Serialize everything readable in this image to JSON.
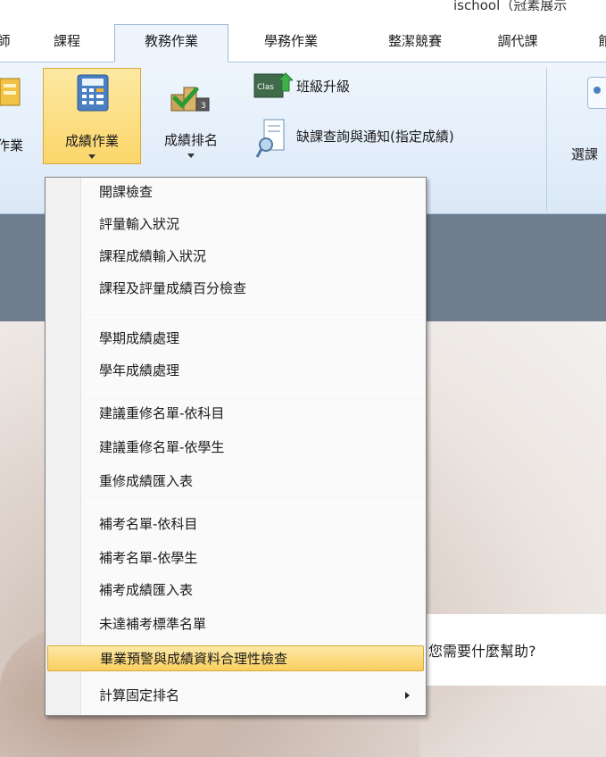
{
  "window": {
    "title": "ischool（冠素展示"
  },
  "tabs": [
    "師",
    "課程",
    "教務作業",
    "學務作業",
    "整潔競賽",
    "調代課",
    "館"
  ],
  "active_tab_index": 2,
  "ribbon": {
    "left_cut_label": "作業",
    "grade_ops_label": "成績作業",
    "grade_rank_label": "成績排名",
    "class_promote_label": "班級升級",
    "absence_notice_label": "缺課查詢與通知(指定成績)",
    "course_select_label": "選課"
  },
  "menu": {
    "groups": [
      [
        "開課檢查",
        "評量輸入狀況",
        "課程成績輸入狀況",
        "課程及評量成績百分檢查"
      ],
      [
        "學期成績處理",
        "學年成績處理"
      ],
      [
        "建議重修名單-依科目",
        "建議重修名單-依學生",
        "重修成績匯入表"
      ],
      [
        "補考名單-依科目",
        "補考名單-依學生",
        "補考成績匯入表",
        "未達補考標準名單",
        "畢業預警與成績資料合理性檢查",
        "計算固定排名"
      ]
    ],
    "highlighted_item": "畢業預警與成績資料合理性檢查",
    "submenu_item": "計算固定排名"
  },
  "help": {
    "prompt": "您需要什麼幫助?"
  },
  "colors": {
    "ribbon_bg": "#e3eefa",
    "highlight": "#fbd66a",
    "band": "#6f7d8d"
  }
}
